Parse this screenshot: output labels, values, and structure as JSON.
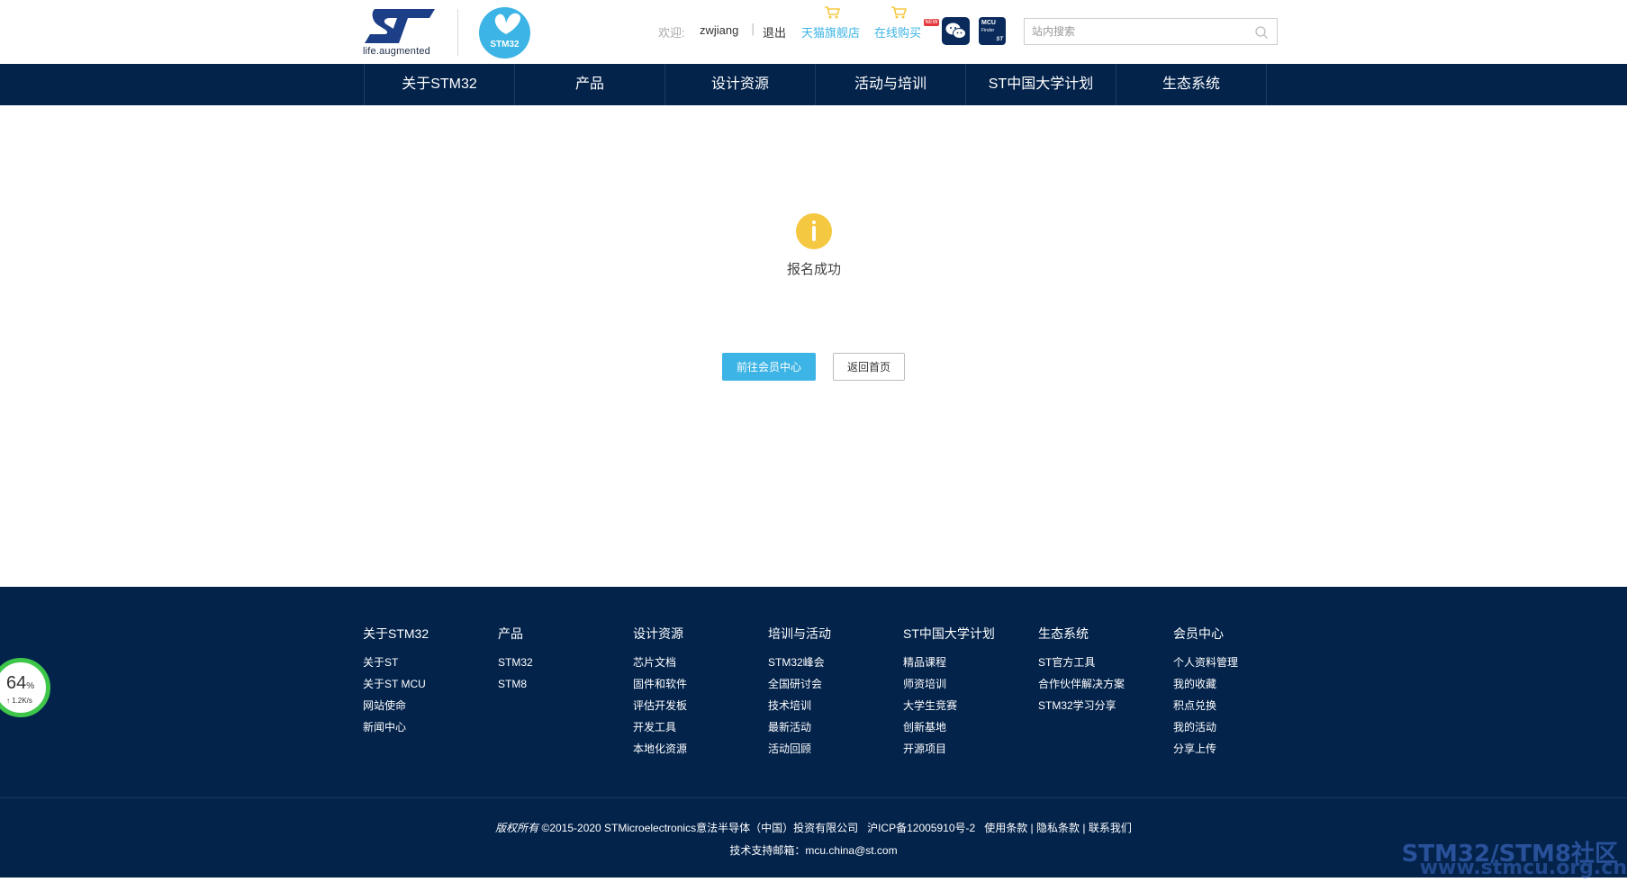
{
  "header": {
    "logo_tagline": "life.augmented",
    "stm32_logo_text": "STM32",
    "welcome_label": "欢迎:",
    "username": "zwjiang",
    "separator": "|",
    "logout": "退出",
    "tmall_store": "天猫旗舰店",
    "online_buy": "在线购买",
    "new_badge": "NEW",
    "mcu_finder": {
      "line1": "MCU",
      "line2": "Finder",
      "brand": "ST"
    },
    "search_placeholder": "站内搜索"
  },
  "nav": {
    "items": [
      "关于STM32",
      "产品",
      "设计资源",
      "活动与培训",
      "ST中国大学计划",
      "生态系统"
    ]
  },
  "main": {
    "status_text": "报名成功",
    "primary_button": "前往会员中心",
    "secondary_button": "返回首页"
  },
  "footer": {
    "columns": [
      {
        "title": "关于STM32",
        "links": [
          "关于ST",
          "关于ST MCU",
          "网站使命",
          "新闻中心"
        ]
      },
      {
        "title": "产品",
        "links": [
          "STM32",
          "STM8"
        ]
      },
      {
        "title": "设计资源",
        "links": [
          "芯片文档",
          "固件和软件",
          "评估开发板",
          "开发工具",
          "本地化资源"
        ]
      },
      {
        "title": "培训与活动",
        "links": [
          "STM32峰会",
          "全国研讨会",
          "技术培训",
          "最新活动",
          "活动回顾"
        ]
      },
      {
        "title": "ST中国大学计划",
        "links": [
          "精品课程",
          "师资培训",
          "大学生竞赛",
          "创新基地",
          "开源项目"
        ]
      },
      {
        "title": "生态系统",
        "links": [
          "ST官方工具",
          "合作伙伴解决方案",
          "STM32学习分享"
        ]
      },
      {
        "title": "会员中心",
        "links": [
          "个人资料管理",
          "我的收藏",
          "积点兑换",
          "我的活动",
          "分享上传"
        ]
      }
    ],
    "copyright_prefix": "版权所有",
    "copyright_text": "©2015-2020 STMicroelectronics意法半导体（中国）投资有限公司",
    "icp": "沪ICP备12005910号-2",
    "terms": "使用条款",
    "privacy": "隐私条款",
    "contact": "联系我们",
    "link_sep": "|",
    "support_label": "技术支持邮箱：",
    "support_email": "mcu.china@st.com"
  },
  "watermark": {
    "line1": "STM32/STM8社区",
    "line2": "www.stmcu.org.cn"
  },
  "speed_widget": {
    "percent": "64",
    "percent_unit": "%",
    "rate": "↑ 1.2K/s"
  },
  "colors": {
    "navy": "#03234b",
    "accent_blue": "#3cb4e5",
    "info_yellow": "#f5c842",
    "speed_green": "#3ec64a"
  }
}
